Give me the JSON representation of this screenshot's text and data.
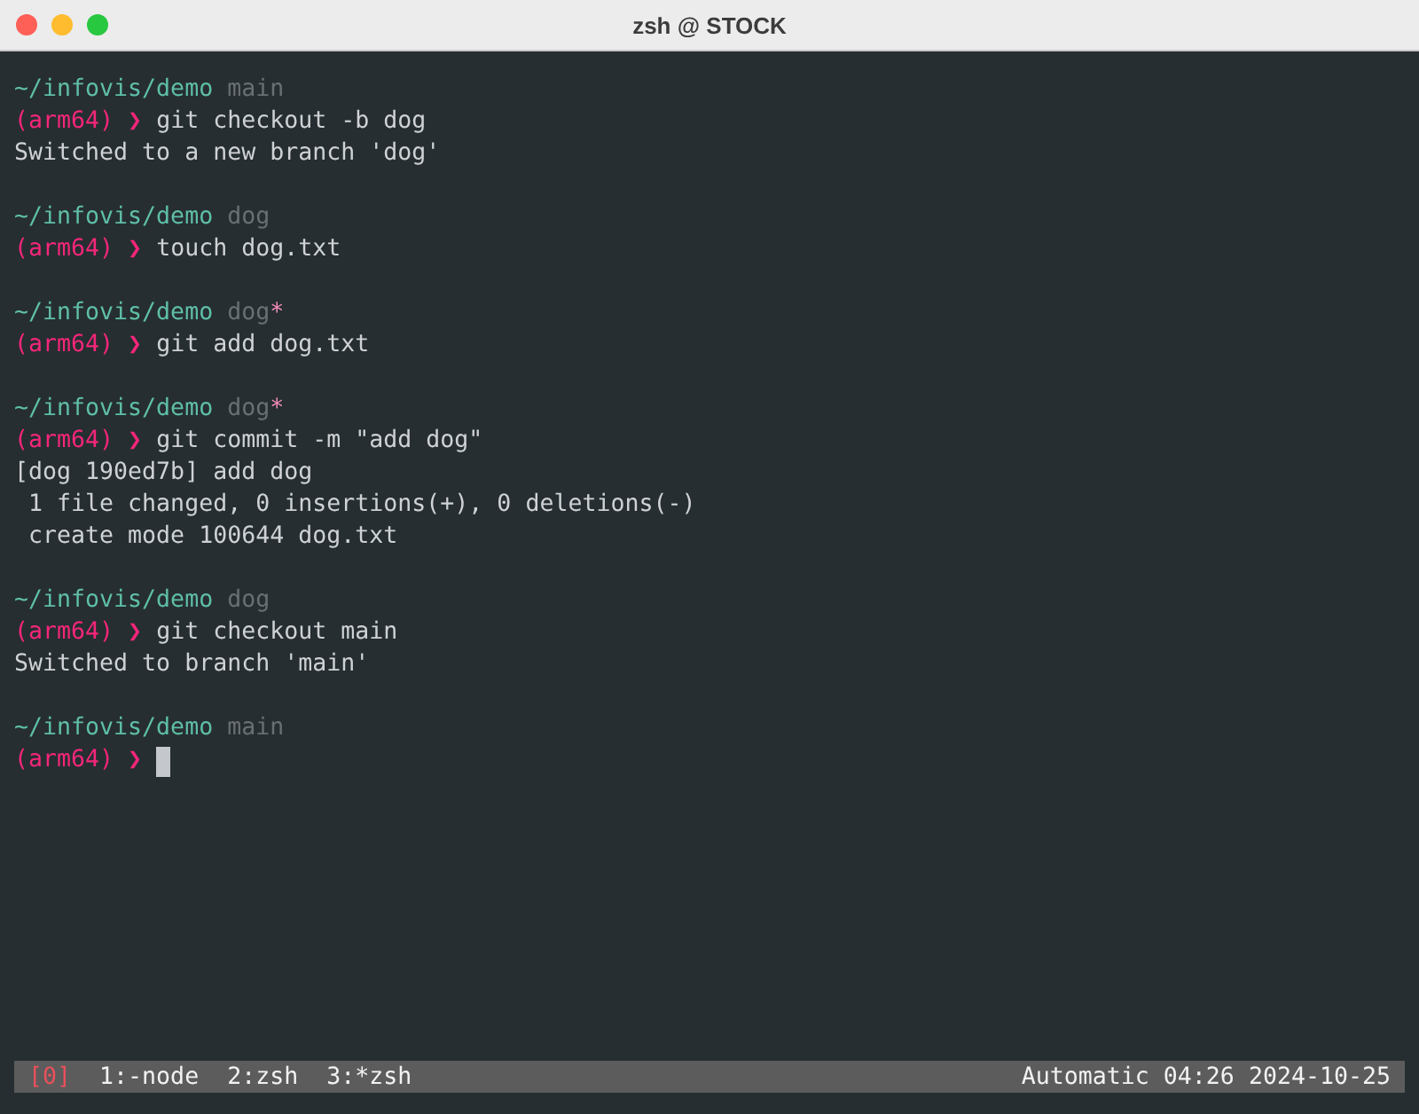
{
  "window": {
    "title": "zsh @ STOCK"
  },
  "blocks": [
    {
      "path": "~/infovis/demo",
      "branch": "main",
      "env": "(arm64)",
      "arrow": "❯",
      "command": "git checkout -b dog",
      "cursor": false,
      "output": [
        "Switched to a new branch 'dog'"
      ]
    },
    {
      "path": "~/infovis/demo",
      "branch": "dog",
      "env": "(arm64)",
      "arrow": "❯",
      "command": "touch dog.txt",
      "cursor": false
    },
    {
      "path": "~/infovis/demo",
      "branch": "dog",
      "dirty_mark": "*",
      "env": "(arm64)",
      "arrow": "❯",
      "command": "git add dog.txt",
      "cursor": false
    },
    {
      "path": "~/infovis/demo",
      "branch": "dog",
      "dirty_mark": "*",
      "env": "(arm64)",
      "arrow": "❯",
      "command": "git commit -m \"add dog\"",
      "cursor": false,
      "output": [
        "[dog 190ed7b] add dog",
        " 1 file changed, 0 insertions(+), 0 deletions(-)",
        " create mode 100644 dog.txt"
      ]
    },
    {
      "path": "~/infovis/demo",
      "branch": "dog",
      "env": "(arm64)",
      "arrow": "❯",
      "command": "git checkout main",
      "cursor": false,
      "output": [
        "Switched to branch 'main'"
      ]
    },
    {
      "path": "~/infovis/demo",
      "branch": "main",
      "env": "(arm64)",
      "arrow": "❯",
      "cursor": true
    }
  ],
  "status_bar": {
    "session": "[0]",
    "windows": [
      "1:-node",
      "2:zsh",
      "3:*zsh"
    ],
    "right": "Automatic 04:26 2024-10-25"
  }
}
